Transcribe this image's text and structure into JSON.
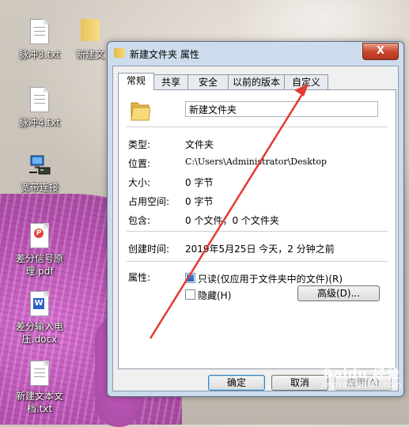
{
  "desktop": {
    "icons": [
      {
        "label": "脉冲3.txt"
      },
      {
        "label": "新建文"
      },
      {
        "label": "脉冲4.txt"
      },
      {
        "label": "宽带连接"
      },
      {
        "label": "差分信号原理.pdf"
      },
      {
        "label": "差分输入电压.docx"
      },
      {
        "label": "新建文本文档.txt"
      }
    ]
  },
  "dialog": {
    "title": "新建文件夹 属性",
    "close_label": "X",
    "tabs": [
      {
        "label": "常规",
        "active": true
      },
      {
        "label": "共享"
      },
      {
        "label": "安全"
      },
      {
        "label": "以前的版本"
      },
      {
        "label": "自定义"
      }
    ],
    "general": {
      "name_value": "新建文件夹",
      "rows": [
        {
          "label": "类型:",
          "value": "文件夹"
        },
        {
          "label": "位置:",
          "value": "C:\\Users\\Administrator\\Desktop"
        },
        {
          "label": "大小:",
          "value": "0 字节"
        },
        {
          "label": "占用空间:",
          "value": "0 字节"
        },
        {
          "label": "包含:",
          "value": "0 个文件，0 个文件夹"
        }
      ],
      "created_label": "创建时间:",
      "created_value": "2019年5月25日 今天，2 分钟之前",
      "attributes_label": "属性:",
      "readonly_label": "只读(仅应用于文件夹中的文件)(R)",
      "hidden_label": "隐藏(H)",
      "advanced_button": "高级(D)..."
    },
    "buttons": {
      "ok": "确定",
      "cancel": "取消",
      "apply": "应用(A)"
    }
  },
  "watermark": {
    "brand": "Baidu 经验",
    "url": "jingyan.baidu.com"
  },
  "colors": {
    "annotation_arrow": "#e53935",
    "dialog_frame": "#cddcec",
    "close_button": "#c7432a"
  }
}
